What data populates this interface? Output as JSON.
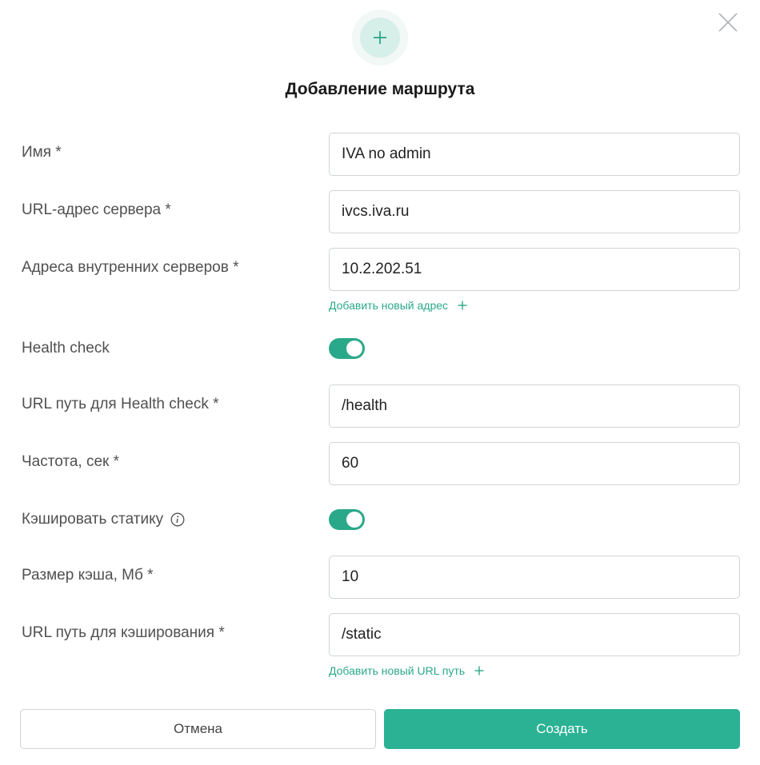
{
  "dialog": {
    "title": "Добавление маршрута"
  },
  "fields": {
    "name": {
      "label": "Имя *",
      "value": "IVA no admin"
    },
    "server_url": {
      "label": "URL-адрес сервера *",
      "value": "ivcs.iva.ru"
    },
    "internal_servers": {
      "label": "Адреса внутренних серверов *",
      "value": "10.2.202.51",
      "add_label": "Добавить новый адрес"
    },
    "health_check": {
      "label": "Health check",
      "enabled": true
    },
    "health_path": {
      "label": "URL путь для Health check *",
      "value": "/health"
    },
    "frequency": {
      "label": "Частота, сек *",
      "value": "60"
    },
    "cache_static": {
      "label": "Кэшировать статику",
      "enabled": true
    },
    "cache_size": {
      "label": "Размер кэша, Мб *",
      "value": "10"
    },
    "cache_path": {
      "label": "URL путь для кэширования *",
      "value": "/static",
      "add_label": "Добавить новый URL путь"
    }
  },
  "buttons": {
    "cancel": "Отмена",
    "create": "Создать"
  },
  "colors": {
    "accent": "#2bb294",
    "accent_text": "#2aa88a",
    "icon_bg": "#d6efe8"
  },
  "icons": {
    "close": "close-icon",
    "header": "plus-icon",
    "info": "info-icon",
    "add": "plus-icon"
  }
}
